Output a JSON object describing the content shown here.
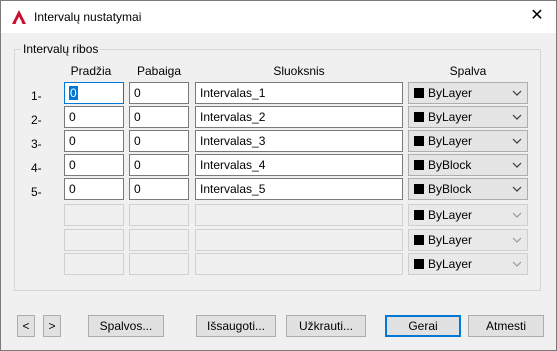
{
  "window": {
    "title": "Intervalų nustatymai",
    "close_glyph": "✕"
  },
  "group": {
    "label": "Intervalų ribos"
  },
  "headers": {
    "start": "Pradžia",
    "end": "Pabaiga",
    "layer": "Sluoksnis",
    "color": "Spalva"
  },
  "rows": [
    {
      "num": "1-",
      "start": "0",
      "end": "0",
      "layer": "Intervalas_1",
      "color": "ByLayer"
    },
    {
      "num": "2-",
      "start": "0",
      "end": "0",
      "layer": "Intervalas_2",
      "color": "ByLayer"
    },
    {
      "num": "3-",
      "start": "0",
      "end": "0",
      "layer": "Intervalas_3",
      "color": "ByLayer"
    },
    {
      "num": "4-",
      "start": "0",
      "end": "0",
      "layer": "Intervalas_4",
      "color": "ByBlock"
    },
    {
      "num": "5-",
      "start": "0",
      "end": "0",
      "layer": "Intervalas_5",
      "color": "ByBlock"
    }
  ],
  "disabled_rows": [
    {
      "color": "ByLayer"
    },
    {
      "color": "ByLayer"
    },
    {
      "color": "ByLayer"
    }
  ],
  "buttons": {
    "prev": "<",
    "next": ">",
    "colors": "Spalvos...",
    "save": "Išsaugoti...",
    "load": "Užkrauti...",
    "ok": "Gerai",
    "cancel": "Atmesti"
  },
  "colors": {
    "accent": "#0078d7",
    "brand_icon": "#c8102e",
    "swatch": "#000000"
  }
}
